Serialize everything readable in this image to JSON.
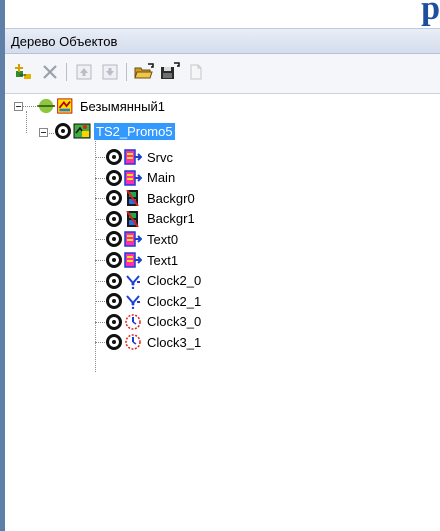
{
  "panel": {
    "title": "Дерево Объектов"
  },
  "corner_glyph": "р",
  "toolbar": {
    "buttons": [
      {
        "icon": "add-object-icon"
      },
      {
        "icon": "delete-icon"
      },
      {
        "icon": "move-up-icon"
      },
      {
        "icon": "move-down-icon"
      },
      {
        "icon": "open-folder-icon"
      },
      {
        "icon": "save-icon"
      },
      {
        "icon": "new-document-icon"
      }
    ]
  },
  "tree": {
    "root": {
      "label": "Безымянный1",
      "icon": "root-scene-icon"
    },
    "project": {
      "label": "TS2_Promo5",
      "icon": "project-icon",
      "selected": true
    },
    "items": [
      {
        "label": "Srvc",
        "icon": "script-icon"
      },
      {
        "label": "Main",
        "icon": "script-icon"
      },
      {
        "label": "Backgr0",
        "icon": "film-icon"
      },
      {
        "label": "Backgr1",
        "icon": "film-icon"
      },
      {
        "label": "Text0",
        "icon": "script-icon"
      },
      {
        "label": "Text1",
        "icon": "script-icon"
      },
      {
        "label": "Clock2_0",
        "icon": "clock-digital-icon"
      },
      {
        "label": "Clock2_1",
        "icon": "clock-digital-icon"
      },
      {
        "label": "Clock3_0",
        "icon": "clock-analog-icon"
      },
      {
        "label": "Clock3_1",
        "icon": "clock-analog-icon"
      }
    ]
  },
  "colors": {
    "selection": "#3399ff",
    "header_bg": "#dce4f0",
    "left_border": "#5d7fa8"
  }
}
